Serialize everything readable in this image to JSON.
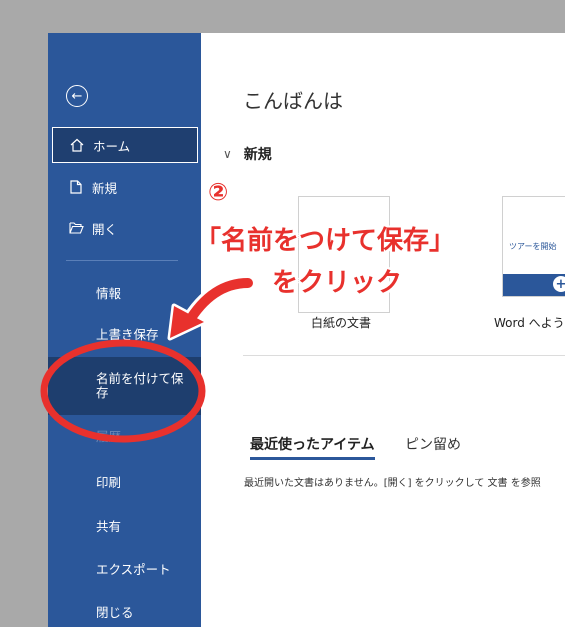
{
  "sidebar": {
    "back_icon": "arrow-left-circle-icon",
    "home": "ホーム",
    "new": "新規",
    "open": "開く",
    "info": "情報",
    "save": "上書き保存",
    "save_as": "名前を付けて保存",
    "history": "履歴",
    "print": "印刷",
    "share": "共有",
    "export": "エクスポート",
    "close": "閉じる"
  },
  "main": {
    "greeting": "こんばんは",
    "new_section": "新規",
    "templates": [
      {
        "label": "白紙の文書"
      },
      {
        "label": "Word へよう",
        "preview_text": "ツアーを開始"
      }
    ],
    "tabs": [
      "最近使ったアイテム",
      "ピン留め"
    ],
    "recent_message": "最近開いた文書はありません。[開く] をクリックして 文書 を参照"
  },
  "annotation": {
    "step": "②",
    "line1": "「名前をつけて保存」",
    "line2": "をクリック",
    "color": "#e8312d"
  },
  "colors": {
    "sidebar": "#2b579a",
    "accent": "#2b579a"
  }
}
